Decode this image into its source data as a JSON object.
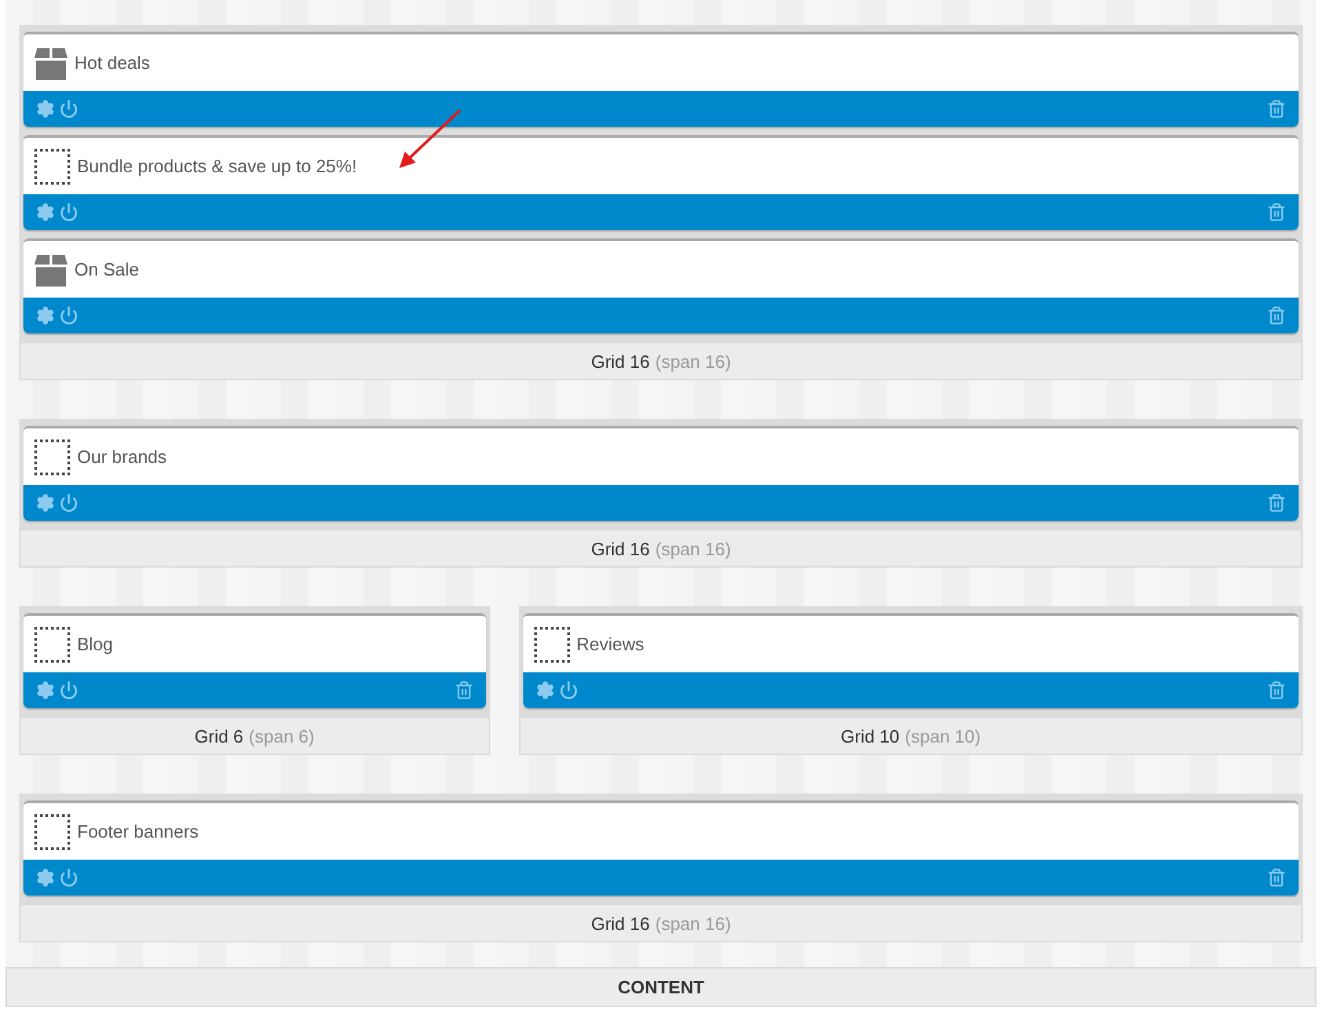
{
  "rows": [
    {
      "grids": [
        {
          "kind": "full",
          "label": "Grid 16",
          "span": "(span 16)",
          "modules": [
            {
              "kind": "box",
              "title": "Hot deals"
            },
            {
              "kind": "placeholder",
              "title": "Bundle products & save up to 25%!"
            },
            {
              "kind": "box",
              "title": "On Sale"
            }
          ]
        }
      ]
    },
    {
      "grids": [
        {
          "kind": "full",
          "label": "Grid 16",
          "span": "(span 16)",
          "modules": [
            {
              "kind": "placeholder",
              "title": "Our brands"
            }
          ]
        }
      ]
    },
    {
      "grids": [
        {
          "kind": "narrow",
          "label": "Grid 6",
          "span": "(span 6)",
          "modules": [
            {
              "kind": "placeholder",
              "title": "Blog"
            }
          ]
        },
        {
          "kind": "wide",
          "label": "Grid 10",
          "span": "(span 10)",
          "modules": [
            {
              "kind": "placeholder",
              "title": "Reviews"
            }
          ]
        }
      ]
    },
    {
      "grids": [
        {
          "kind": "full",
          "label": "Grid 16",
          "span": "(span 16)",
          "modules": [
            {
              "kind": "placeholder",
              "title": "Footer banners"
            }
          ]
        }
      ]
    }
  ],
  "section_label": "CONTENT"
}
